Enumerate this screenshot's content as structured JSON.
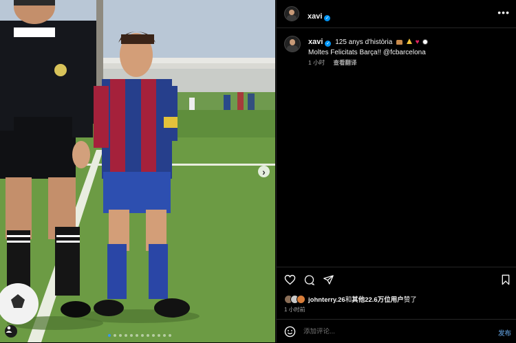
{
  "post": {
    "username": "xavi",
    "verified_mark": "✓",
    "caption_text": "125 anys d'història",
    "caption_emojis": [
      "cake",
      "party",
      "heart",
      "soccer-ball"
    ],
    "caption_line2": "Moltes Felicitats Barça!! @fcbarcelona",
    "time_ago": "1 小时",
    "translate_label": "查看翻译",
    "more_label": "•••",
    "next_label": "›"
  },
  "likes": {
    "first_user": "johnterry.26",
    "joiner": "和",
    "others": "其他22.6万位用户",
    "suffix": "赞了",
    "time": "1 小时前"
  },
  "comment": {
    "placeholder": "添加评论...",
    "post_label": "发布"
  },
  "carousel": {
    "slide_count": 12,
    "current_index": 0
  },
  "colors": {
    "accent": "#0095f6",
    "background": "#000000",
    "divider": "#262626"
  }
}
